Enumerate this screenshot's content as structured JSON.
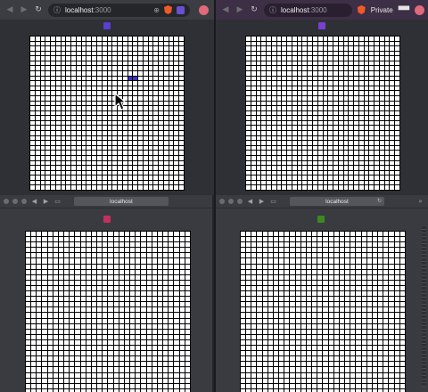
{
  "windows": [
    {
      "id": "tl",
      "browser": "chrome",
      "url": {
        "host": "localhost",
        "port": ":3000"
      },
      "player_color": "#5a3fd0",
      "highlighted_cells": [
        {
          "row": 8,
          "col": 19
        },
        {
          "row": 8,
          "col": 20
        }
      ],
      "highlight_color": "#3f2fc7"
    },
    {
      "id": "tr",
      "browser": "brave-private",
      "url": {
        "host": "localhost",
        "port": ":3000"
      },
      "private_label": "Private",
      "player_color": "#7a40d0",
      "highlighted_cells": []
    },
    {
      "id": "bl",
      "browser": "safari",
      "url_text": "localhost",
      "player_color": "#c23060",
      "highlighted_cells": []
    },
    {
      "id": "br",
      "browser": "safari",
      "url_text": "localhost",
      "player_color": "#3b8a20",
      "highlighted_cells": []
    }
  ],
  "grid": {
    "rows": 31,
    "cols": 30
  },
  "icons": {
    "back": "◀",
    "forward": "▶",
    "reload": "↻",
    "info": "ⓘ",
    "zoom": "⊕",
    "sidebar": "▭",
    "double_chevron": "»"
  }
}
